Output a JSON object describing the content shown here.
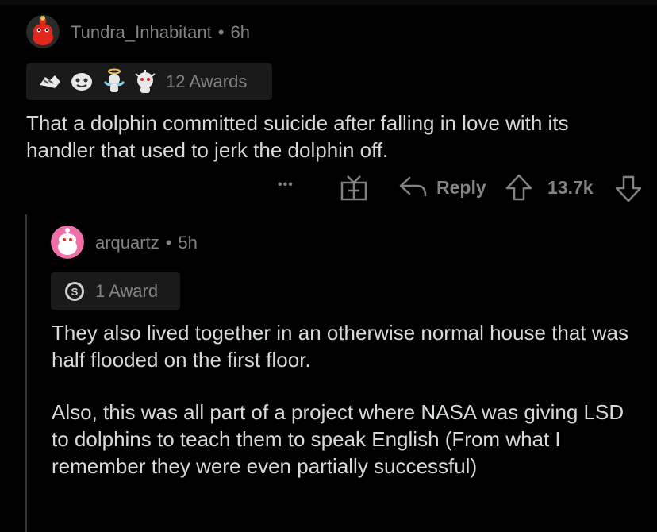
{
  "comment1": {
    "username": "Tundra_Inhabitant",
    "separator": "•",
    "time": "6h",
    "awards_label": "12 Awards",
    "body": "That a dolphin committed suicide after falling in love with its handler that used to jerk the dolphin off.",
    "more_label": "•••",
    "reply_label": "Reply",
    "score": "13.7k"
  },
  "comment2": {
    "username": "arquartz",
    "separator": "•",
    "time": "5h",
    "awards_label": "1 Award",
    "paragraph1": "They also lived together in an otherwise normal house that was half flooded on the first floor.",
    "paragraph2": "Also, this was all part of a project where NASA was giving LSD to dolphins to teach them to speak English (From what I remember they were even partially successful)"
  },
  "colors": {
    "background": "#000000",
    "text": "#d7dadc",
    "muted": "#818384",
    "award_bg": "#1a1a1b",
    "thread_line": "#343536"
  }
}
